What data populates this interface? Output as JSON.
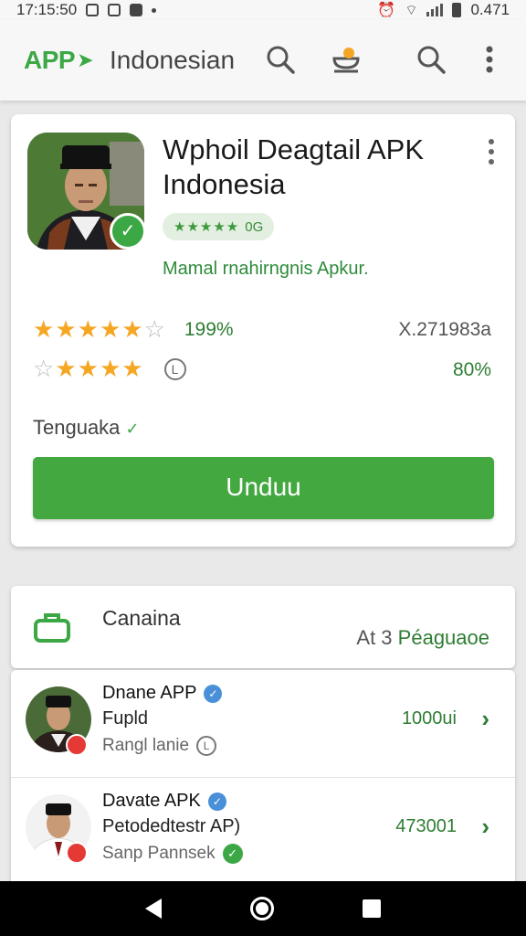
{
  "status_bar": {
    "time": "17:15:50",
    "battery_text": "0.471"
  },
  "app_bar": {
    "logo": "APP",
    "title": "Indonesian",
    "icons": [
      "search-icon",
      "notification-icon",
      "search-icon",
      "more-vert-icon"
    ]
  },
  "detail": {
    "title": "Wphoil Deagtail APK Indonesia",
    "rating_pill": {
      "stars": "★★★★★",
      "text": "0G"
    },
    "developer": "Mamal rnahirngnis Apkur.",
    "rating_row_1": {
      "stars": 5,
      "max": 6,
      "percent": "199%",
      "right": "X.271983a"
    },
    "rating_row_2": {
      "stars": 4,
      "max": 5,
      "icon_label": "L",
      "right": "80%"
    },
    "status_label": "Tenguaka",
    "download_button": "Unduu",
    "colors": {
      "accent": "#43a83f",
      "star": "#f5a623"
    }
  },
  "section": {
    "title": "Canaina",
    "more_prefix": "At 3",
    "more_label": "Péaguaoe"
  },
  "list": [
    {
      "name": "Dnane APP",
      "subtitle": "Fupld",
      "meta": "Rangl lanie",
      "meta_icon_label": "L",
      "count": "1000ui"
    },
    {
      "name": "Davate APK",
      "subtitle": "Petodedtestr AP)",
      "meta": "Sanp Pannsek",
      "meta_icon_label": "✓",
      "count": "473001"
    }
  ]
}
